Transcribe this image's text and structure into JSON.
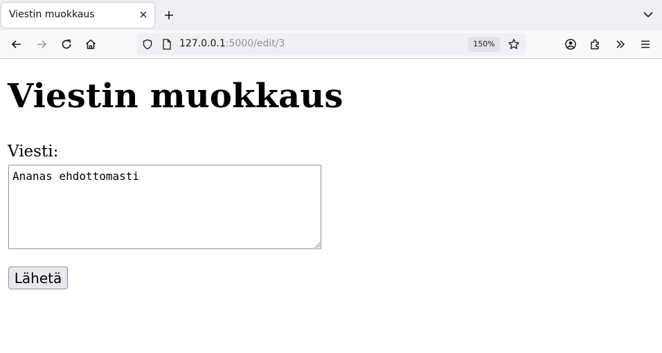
{
  "browser": {
    "tab": {
      "title": "Viestin muokkaus",
      "close_icon": "close-icon"
    },
    "new_tab_icon": "plus-icon",
    "tab_list_icon": "chevron-down-icon",
    "nav": {
      "back_icon": "arrow-left-icon",
      "forward_icon": "arrow-right-icon",
      "reload_icon": "reload-icon",
      "home_icon": "home-icon"
    },
    "url": {
      "host": "127.0.0.1",
      "path": ":5000/edit/3"
    },
    "zoom": "150%",
    "toolbar_icons": [
      "account-icon",
      "extensions-icon",
      "overflow-icon",
      "menu-icon"
    ]
  },
  "page": {
    "heading": "Viestin muokkaus",
    "message_label": "Viesti:",
    "message_value": "Ananas ehdottomasti",
    "submit_label": "Lähetä"
  }
}
